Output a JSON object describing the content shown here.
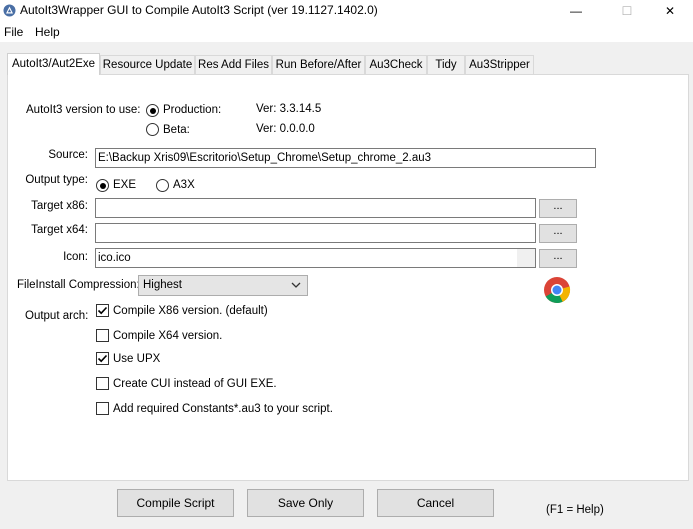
{
  "window": {
    "title": "AutoIt3Wrapper GUI to Compile AutoIt3 Script (ver 19.1127.1402.0)",
    "minimize_glyph": "—",
    "maximize_glyph": "☐",
    "close_glyph": "✕"
  },
  "menu": {
    "file": "File",
    "help": "Help"
  },
  "tabs": [
    {
      "label": "AutoIt3/Aut2Exe",
      "active": true
    },
    {
      "label": "Resource Update",
      "active": false
    },
    {
      "label": "Res Add Files",
      "active": false
    },
    {
      "label": "Run Before/After",
      "active": false
    },
    {
      "label": "Au3Check",
      "active": false
    },
    {
      "label": "Tidy",
      "active": false
    },
    {
      "label": "Au3Stripper",
      "active": false
    }
  ],
  "version_section": {
    "label": "AutoIt3 version to use:",
    "production_label": "Production:",
    "production_selected": true,
    "production_version": "Ver: 3.3.14.5",
    "beta_label": "Beta:",
    "beta_selected": false,
    "beta_version": "Ver: 0.0.0.0"
  },
  "source": {
    "label": "Source:",
    "value": "E:\\Backup Xris09\\Escritorio\\Setup_Chrome\\Setup_chrome_2.au3"
  },
  "output_type": {
    "label": "Output type:",
    "exe_label": "EXE",
    "exe_selected": true,
    "a3x_label": "A3X",
    "a3x_selected": false
  },
  "target_x86": {
    "label": "Target x86:",
    "value": "",
    "browse_label": "..."
  },
  "target_x64": {
    "label": "Target x64:",
    "value": "",
    "browse_label": "..."
  },
  "icon_field": {
    "label": "Icon:",
    "value": "ico.ico",
    "browse_label": "...",
    "preview_icon": "chrome-icon"
  },
  "compression": {
    "label": "FileInstall Compression:",
    "selected": "Highest"
  },
  "output_arch": {
    "label": "Output arch:",
    "options": [
      {
        "label": "Compile X86 version. (default)",
        "checked": true
      },
      {
        "label": "Compile X64 version.",
        "checked": false
      },
      {
        "label": "Use UPX",
        "checked": true
      },
      {
        "label": "Create CUI instead of GUI EXE.",
        "checked": false
      },
      {
        "label": "Add required Constants*.au3 to your script.",
        "checked": false
      }
    ]
  },
  "buttons": {
    "compile": "Compile Script",
    "save": "Save Only",
    "cancel": "Cancel",
    "help_hint": "(F1 = Help)"
  },
  "colors": {
    "window_bg": "#f0f0f0",
    "panel_bg": "#ffffff",
    "button_bg": "#e1e1e1"
  }
}
